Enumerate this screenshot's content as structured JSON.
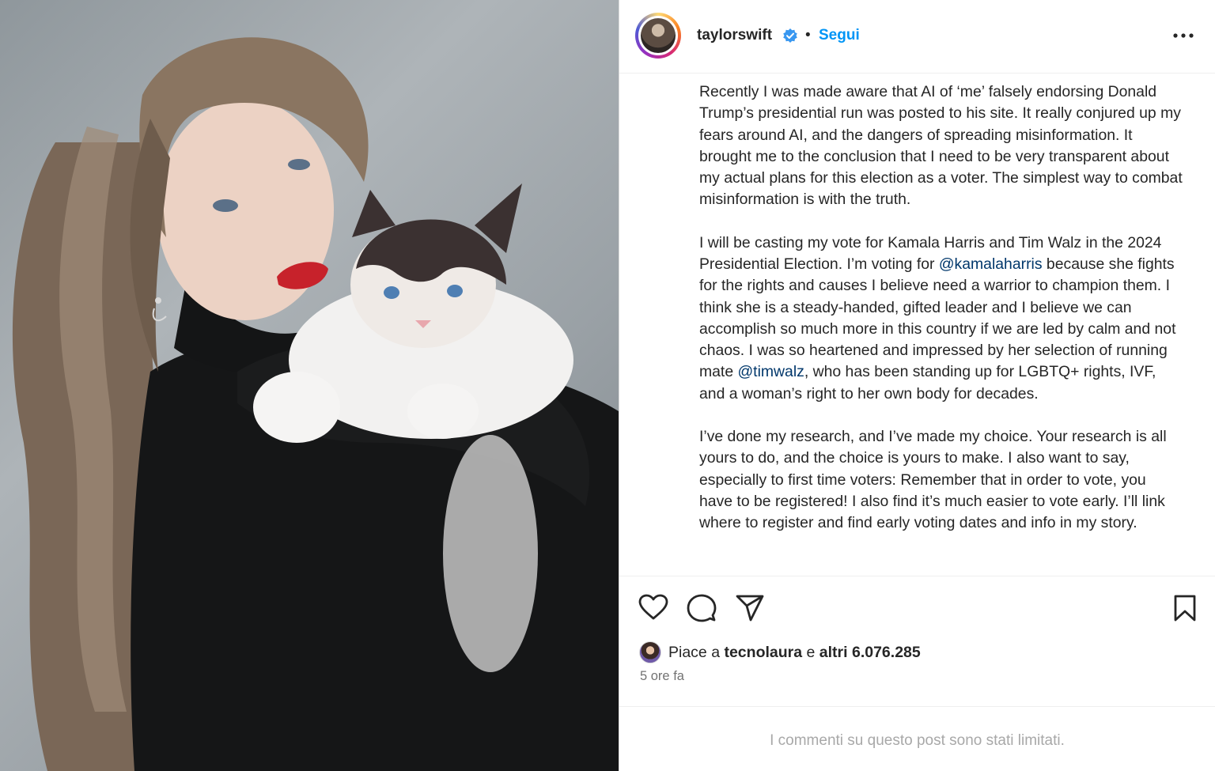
{
  "post": {
    "username": "taylorswift",
    "follow_label": "Segui",
    "separator": "•",
    "caption_paragraphs": [
      "Recently I was made aware that AI of ‘me’ falsely endorsing Donald Trump’s presidential run was posted to his site. It really conjured up my fears around AI, and the dangers of spreading misinformation. It brought me to the conclusion that I need to be very transparent about my actual plans for this election as a voter. The simplest way to combat misinformation is with the truth.",
      "I will be casting my vote for Kamala Harris and Tim Walz in the 2024 Presidential Election. I’m voting for ",
      "@kamalaharris",
      " because she fights for the rights and causes I believe need a warrior to champion them. I think she is a steady-handed, gifted leader and I believe we can accomplish so much more in this country if we are led by calm and not chaos. I was so heartened and impressed by her selection of running mate ",
      "@timwalz",
      ", who has been standing up for LGBTQ+ rights, IVF, and a woman’s right to her own body for decades.",
      "I’ve done my research, and I’ve made my choice. Your research is all yours to do, and the choice is yours to make. I also want to say, especially to first time voters: Remember that in order to vote, you have to be registered! I also find it’s much easier to vote early. I’ll link where to register and find early voting dates and info in my story."
    ],
    "likes": {
      "prefix": "Piace a",
      "liker": "tecnolaura",
      "middle": "e",
      "others": "altri 6.076.285"
    },
    "time_ago": "5 ore fa",
    "comments_limited": "I commenti su questo post sono stati limitati."
  },
  "icons": {
    "verified": "verified-badge-icon",
    "more": "more-options-icon",
    "like": "heart-icon",
    "comment": "comment-bubble-icon",
    "share": "paper-plane-icon",
    "save": "bookmark-icon"
  },
  "colors": {
    "accent": "#0095f6",
    "mention": "#00376b",
    "muted": "#737373",
    "footer": "#a8a8a8"
  }
}
